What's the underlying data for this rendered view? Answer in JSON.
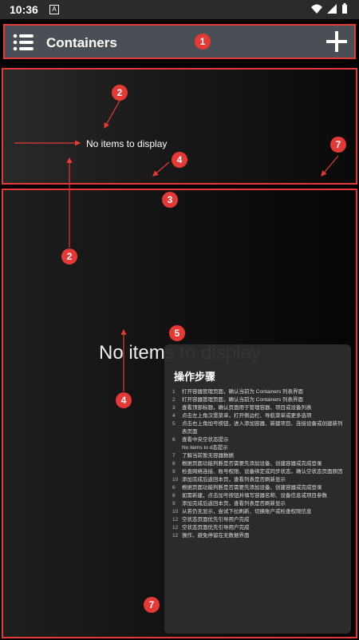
{
  "status_bar": {
    "time": "10:36"
  },
  "app_bar": {
    "title": "Containers"
  },
  "panel1": {
    "empty_text": "No items to display"
  },
  "panel2": {
    "empty_text": "No items to display"
  },
  "steps": {
    "title": "操作步骤",
    "items": [
      {
        "n": "1",
        "text": "打开容器管理页面，确认当前为 Containers 列表界面"
      },
      {
        "n": "2",
        "text": "打开容器管理页面，确认当前为 Containers 列表界面"
      },
      {
        "n": "3",
        "text": "查看顶部标题，确认页面用于管理容器、项目或设备列表"
      },
      {
        "n": "4",
        "text": "点击左上角汉堡菜单，打开侧边栏、导航菜单或更多选项"
      },
      {
        "n": "5",
        "text": "点击右上角加号按钮，进入添加容器、新建项目、连接设备或创建新列表页面"
      },
      {
        "n": "6",
        "text": "查看中央空状态提示"
      },
      {
        "n": "",
        "text": "No items to d态提示"
      },
      {
        "n": "7",
        "text": "了解当前暂无容器数据"
      },
      {
        "n": "8",
        "text": "根据页面功能判断是否需要先添加设备、创建容器或完成登录"
      },
      {
        "n": "9",
        "text": "检查网络连接、账号权限、设备绑定或同步状态，确认空状态页面原因"
      },
      {
        "n": "10",
        "text": "添加完成后返回本页，查看列表是否刷新显示"
      },
      {
        "n": "6",
        "text": "根据页面功能判断是否需要先添加设备、创建容器或完成登录"
      },
      {
        "n": "8",
        "text": "如需新建，点击加号按钮并填写容器名称、设备信息或项目参数"
      },
      {
        "n": "9",
        "text": "添加完成后返回本页，查看列表是否刷新显示"
      },
      {
        "n": "10",
        "text": "从若仍无显示，尝试下拉刷新、切换账户或检查权限信息"
      },
      {
        "n": "12",
        "text": "空状态页面优先引导用户完成"
      },
      {
        "n": "12",
        "text": "空状态页面优先引导用户完成"
      },
      {
        "n": "12",
        "text": "操作，避免停留在无数据界面"
      }
    ]
  },
  "markers": [
    "1",
    "2",
    "2",
    "3",
    "4",
    "4",
    "5",
    "7",
    "7"
  ],
  "colors": {
    "accent": "#e53935",
    "app_bar": "#4a4f55",
    "status_bar": "#2b2b2b"
  }
}
